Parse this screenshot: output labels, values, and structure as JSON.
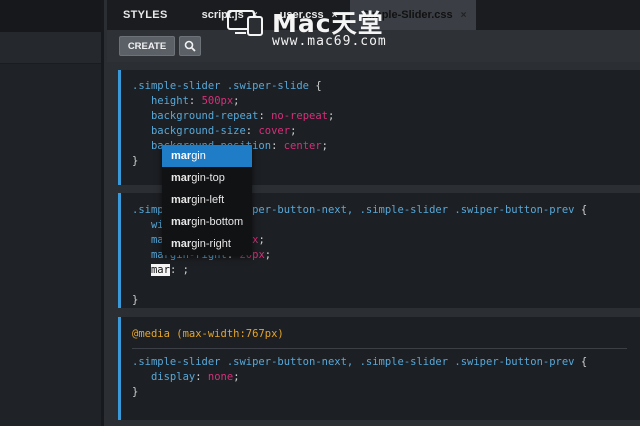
{
  "tabs": [
    {
      "label": "STYLES",
      "closable": false,
      "active": false
    },
    {
      "label": "script.js",
      "closable": true,
      "active": false
    },
    {
      "label": "user.css",
      "closable": true,
      "active": false
    },
    {
      "label": "Simple-Slider.css",
      "closable": true,
      "active": true
    }
  ],
  "close_glyph": "×",
  "toolbar": {
    "create_label": "CREATE",
    "search_icon": "search-icon"
  },
  "watermark": {
    "title": "Mac天堂",
    "url": "www.mac69.com"
  },
  "code": {
    "block1": {
      "selector": ".simple-slider .swiper-slide",
      "declarations": [
        {
          "prop": "height",
          "val": "500px"
        },
        {
          "prop": "background-repeat",
          "val": "no-repeat"
        },
        {
          "prop": "background-size",
          "val": "cover"
        },
        {
          "prop": "background-position",
          "val": "center"
        }
      ]
    },
    "block2": {
      "selector": ".simple-slider .swiper-button-next, .simple-slider .swiper-button-prev",
      "declarations": [
        {
          "prop": "width",
          "val": "50px"
        },
        {
          "prop": "margin-left",
          "val": "20px"
        },
        {
          "prop": "margin-right",
          "val": "20px"
        }
      ],
      "typing": "mar",
      "typing_rest": ": ;"
    },
    "block3": {
      "media": "@media (max-width:767px)",
      "selector": ".simple-slider .swiper-button-next, .simple-slider .swiper-button-prev",
      "declarations": [
        {
          "prop": "display",
          "val": "none"
        }
      ]
    }
  },
  "autocomplete": {
    "match": "mar",
    "items": [
      {
        "label": "margin",
        "selected": true
      },
      {
        "label": "margin-top",
        "selected": false
      },
      {
        "label": "margin-left",
        "selected": false
      },
      {
        "label": "margin-bottom",
        "selected": false
      },
      {
        "label": "margin-right",
        "selected": false
      }
    ]
  },
  "colors": {
    "accent": "#3a9ad9",
    "selector": "#58a8d8",
    "value": "#d6307a",
    "media": "#e5a52a",
    "selected_item": "#1f7cc6"
  }
}
